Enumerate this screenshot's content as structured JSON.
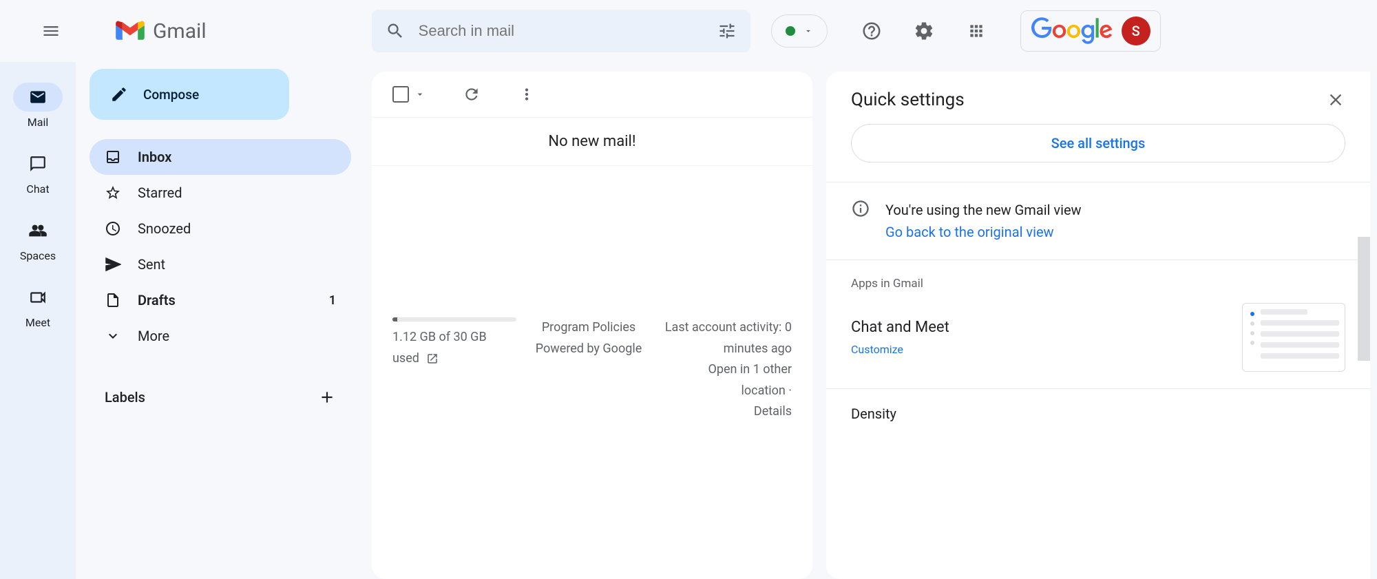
{
  "header": {
    "app_name": "Gmail",
    "search_placeholder": "Search in mail",
    "google_label": "Google",
    "avatar_letter": "S"
  },
  "rail": [
    {
      "label": "Mail",
      "icon": "mail",
      "active": true
    },
    {
      "label": "Chat",
      "icon": "chat",
      "active": false
    },
    {
      "label": "Spaces",
      "icon": "spaces",
      "active": false
    },
    {
      "label": "Meet",
      "icon": "meet",
      "active": false
    }
  ],
  "compose_label": "Compose",
  "nav": [
    {
      "label": "Inbox",
      "icon": "inbox",
      "selected": true,
      "bold": true,
      "count": ""
    },
    {
      "label": "Starred",
      "icon": "star",
      "selected": false,
      "bold": false,
      "count": ""
    },
    {
      "label": "Snoozed",
      "icon": "clock",
      "selected": false,
      "bold": false,
      "count": ""
    },
    {
      "label": "Sent",
      "icon": "send",
      "selected": false,
      "bold": false,
      "count": ""
    },
    {
      "label": "Drafts",
      "icon": "draft",
      "selected": false,
      "bold": true,
      "count": "1"
    },
    {
      "label": "More",
      "icon": "expand",
      "selected": false,
      "bold": false,
      "count": ""
    }
  ],
  "labels_heading": "Labels",
  "mail": {
    "empty_message": "No new mail!",
    "storage_used": "1.12 GB of 30 GB used",
    "policies": "Program Policies",
    "powered": "Powered by Google",
    "activity_line1": "Last account activity: 0 minutes ago",
    "activity_line2": "Open in 1 other location ·",
    "details": "Details"
  },
  "settings": {
    "title": "Quick settings",
    "see_all": "See all settings",
    "new_view_msg": "You're using the new Gmail view",
    "go_back": "Go back to the original view",
    "apps_label": "Apps in Gmail",
    "chat_meet": "Chat and Meet",
    "customize": "Customize",
    "density_label": "Density"
  }
}
